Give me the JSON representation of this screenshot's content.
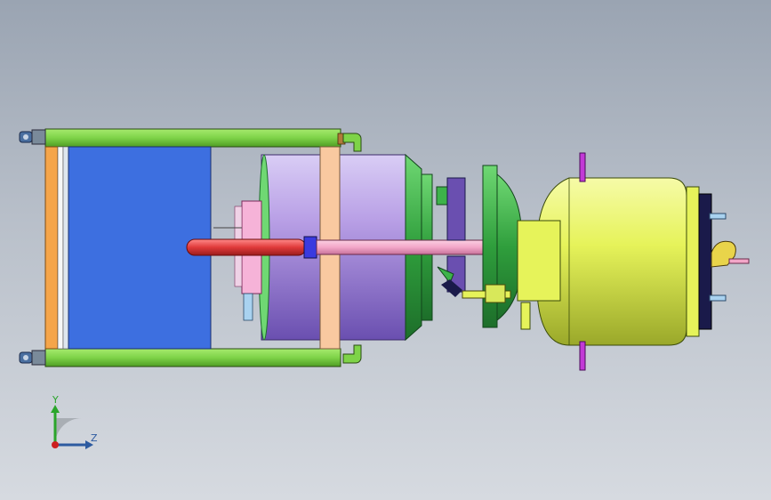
{
  "viewport": {
    "background_top": "#9aa4b2",
    "background_bottom": "#d6dae0"
  },
  "triad": {
    "y_label": "Y",
    "z_label": "Z",
    "y_color": "#2aa52a",
    "z_color": "#2c5aa0",
    "origin_color": "#cc1f1f"
  },
  "colors": {
    "frame_green": "#7ed348",
    "frame_orange": "#f5a54a",
    "panel_blue": "#3d6fe0",
    "cylinder_purple": "#b9a0e6",
    "flange_green": "#3db34a",
    "tank_yellow": "#e6f35a",
    "pipe_pink": "#f3a6c8",
    "pipe_red": "#e03a3a",
    "bracket_peach": "#f9c9a0",
    "pin_magenta": "#c23ad6",
    "dark_navy": "#1a1a4a"
  }
}
